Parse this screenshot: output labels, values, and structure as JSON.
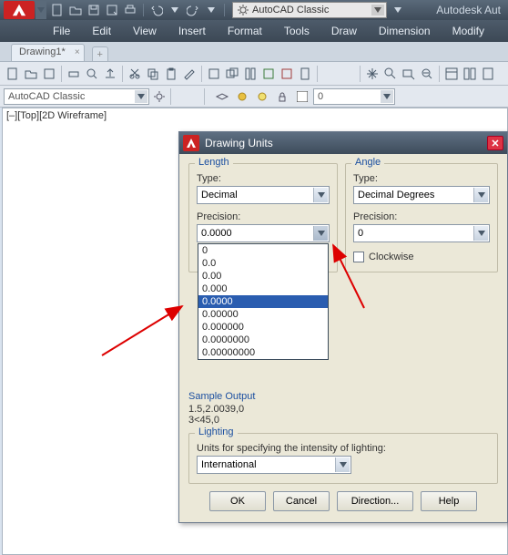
{
  "app": {
    "title_right": "Autodesk Aut",
    "workspace_top": "AutoCAD Classic"
  },
  "menu": [
    "File",
    "Edit",
    "View",
    "Insert",
    "Format",
    "Tools",
    "Draw",
    "Dimension",
    "Modify"
  ],
  "tabs": {
    "active": "Drawing1*"
  },
  "workspace_row": {
    "combo": "AutoCAD Classic"
  },
  "viewport_label": "[–][Top][2D Wireframe]",
  "dialog": {
    "title": "Drawing Units",
    "length": {
      "group": "Length",
      "type_label": "Type:",
      "type_value": "Decimal",
      "precision_label": "Precision:",
      "precision_value": "0.0000",
      "precision_options": [
        "0",
        "0.0",
        "0.00",
        "0.000",
        "0.0000",
        "0.00000",
        "0.000000",
        "0.0000000",
        "0.00000000"
      ],
      "precision_selected_index": 4
    },
    "angle": {
      "group": "Angle",
      "type_label": "Type:",
      "type_value": "Decimal Degrees",
      "precision_label": "Precision:",
      "precision_value": "0",
      "clockwise_label": "Clockwise"
    },
    "sample": {
      "title": "Sample Output",
      "line1": "1.5,2.0039,0",
      "line2": "3<45,0"
    },
    "lighting": {
      "group": "Lighting",
      "subtitle": "Units for specifying the intensity of lighting:",
      "value": "International"
    },
    "buttons": {
      "ok": "OK",
      "cancel": "Cancel",
      "direction": "Direction...",
      "help": "Help"
    }
  }
}
